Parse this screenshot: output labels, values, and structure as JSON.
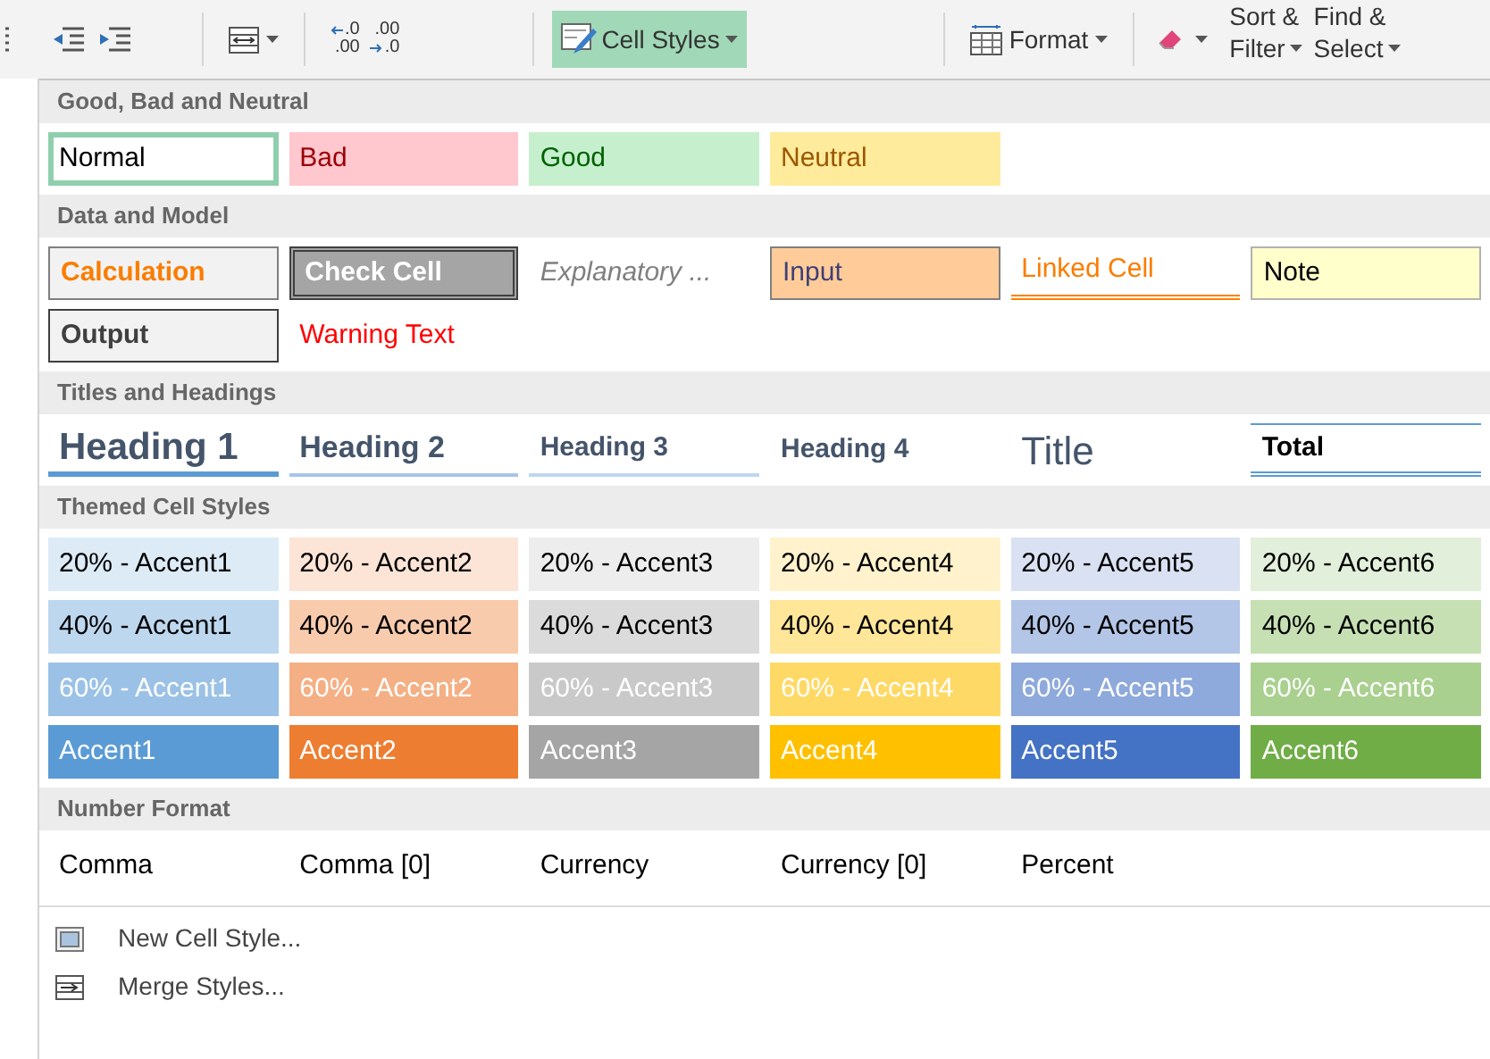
{
  "ribbon": {
    "decimals": [
      {
        "kind": "increase",
        "top": ".0",
        "bottom": ".00"
      },
      {
        "kind": "decrease",
        "top": ".00",
        "bottom": ".0"
      }
    ],
    "cell_styles_button": {
      "label": "Cell Styles",
      "selected": true
    },
    "format_button": {
      "label": "Format"
    },
    "sort_filter": {
      "line1": "Sort &",
      "line2": "Filter"
    },
    "find_select": {
      "line1": "Find &",
      "line2": "Select"
    }
  },
  "sections": [
    {
      "title": "Good, Bad and Neutral",
      "rows": [
        [
          {
            "label": "Normal",
            "kind": "normal",
            "selected": true
          },
          {
            "label": "Bad",
            "kind": "bad",
            "selected": false
          },
          {
            "label": "Good",
            "kind": "good",
            "selected": false
          },
          {
            "label": "Neutral",
            "kind": "neutral",
            "selected": false
          }
        ]
      ]
    },
    {
      "title": "Data and Model",
      "rows": [
        [
          {
            "label": "Calculation",
            "kind": "calculation",
            "selected": false
          },
          {
            "label": "Check Cell",
            "kind": "check",
            "selected": false
          },
          {
            "label": "Explanatory ...",
            "kind": "explanatory",
            "selected": false
          },
          {
            "label": "Input",
            "kind": "input",
            "selected": false
          },
          {
            "label": "Linked Cell",
            "kind": "linked",
            "selected": false
          },
          {
            "label": "Note",
            "kind": "note",
            "selected": false
          }
        ],
        [
          {
            "label": "Output",
            "kind": "output",
            "selected": false
          },
          {
            "label": "Warning Text",
            "kind": "warning",
            "selected": false
          }
        ]
      ]
    },
    {
      "title": "Titles and Headings",
      "rows": [
        [
          {
            "label": "Heading 1",
            "kind": "heading1",
            "selected": false
          },
          {
            "label": "Heading 2",
            "kind": "heading2",
            "selected": false
          },
          {
            "label": "Heading 3",
            "kind": "heading3",
            "selected": false
          },
          {
            "label": "Heading 4",
            "kind": "heading4",
            "selected": false
          },
          {
            "label": "Title",
            "kind": "title",
            "selected": false
          },
          {
            "label": "Total",
            "kind": "total",
            "selected": false
          }
        ]
      ]
    },
    {
      "title": "Themed Cell Styles",
      "rows": [
        [
          {
            "label": "20% - Accent1",
            "kind": "themed-light",
            "color": "#ddebf7",
            "selected": false
          },
          {
            "label": "20% - Accent2",
            "kind": "themed-light",
            "color": "#fce4d6",
            "selected": false
          },
          {
            "label": "20% - Accent3",
            "kind": "themed-light",
            "color": "#ededed",
            "selected": false
          },
          {
            "label": "20% - Accent4",
            "kind": "themed-light",
            "color": "#fff2cc",
            "selected": false
          },
          {
            "label": "20% - Accent5",
            "kind": "themed-light",
            "color": "#d9e1f2",
            "selected": false
          },
          {
            "label": "20% - Accent6",
            "kind": "themed-light",
            "color": "#e2efda",
            "selected": false
          }
        ],
        [
          {
            "label": "40% - Accent1",
            "kind": "themed-light",
            "color": "#bdd7ee",
            "selected": false
          },
          {
            "label": "40% - Accent2",
            "kind": "themed-light",
            "color": "#f8cbad",
            "selected": false
          },
          {
            "label": "40% - Accent3",
            "kind": "themed-light",
            "color": "#dbdbdb",
            "selected": false
          },
          {
            "label": "40% - Accent4",
            "kind": "themed-light",
            "color": "#ffe699",
            "selected": false
          },
          {
            "label": "40% - Accent5",
            "kind": "themed-light",
            "color": "#b4c6e7",
            "selected": false
          },
          {
            "label": "40% - Accent6",
            "kind": "themed-light",
            "color": "#c6e0b4",
            "selected": false
          }
        ],
        [
          {
            "label": "60% - Accent1",
            "kind": "themed-dark",
            "color": "#9bc2e6",
            "selected": false
          },
          {
            "label": "60% - Accent2",
            "kind": "themed-dark",
            "color": "#f4b084",
            "selected": false
          },
          {
            "label": "60% - Accent3",
            "kind": "themed-dark",
            "color": "#c9c9c9",
            "selected": false
          },
          {
            "label": "60% - Accent4",
            "kind": "themed-dark",
            "color": "#ffd966",
            "selected": false
          },
          {
            "label": "60% - Accent5",
            "kind": "themed-dark",
            "color": "#8ea9db",
            "selected": false
          },
          {
            "label": "60% - Accent6",
            "kind": "themed-dark",
            "color": "#a9d08e",
            "selected": false
          }
        ],
        [
          {
            "label": "Accent1",
            "kind": "themed-dark",
            "color": "#5b9bd5",
            "selected": false
          },
          {
            "label": "Accent2",
            "kind": "themed-dark",
            "color": "#ed7d31",
            "selected": false
          },
          {
            "label": "Accent3",
            "kind": "themed-dark",
            "color": "#a5a5a5",
            "selected": false
          },
          {
            "label": "Accent4",
            "kind": "themed-dark",
            "color": "#ffc000",
            "selected": false
          },
          {
            "label": "Accent5",
            "kind": "themed-dark",
            "color": "#4472c4",
            "selected": false
          },
          {
            "label": "Accent6",
            "kind": "themed-dark",
            "color": "#70ad47",
            "selected": false
          }
        ]
      ]
    },
    {
      "title": "Number Format",
      "rows": [
        [
          {
            "label": "Comma",
            "kind": "plain",
            "selected": false
          },
          {
            "label": "Comma [0]",
            "kind": "plain",
            "selected": false
          },
          {
            "label": "Currency",
            "kind": "plain",
            "selected": false
          },
          {
            "label": "Currency [0]",
            "kind": "plain",
            "selected": false
          },
          {
            "label": "Percent",
            "kind": "plain",
            "selected": false
          }
        ]
      ]
    }
  ],
  "menu_items": [
    {
      "label": "New Cell Style...",
      "kind": "new"
    },
    {
      "label": "Merge Styles...",
      "kind": "merge"
    }
  ]
}
